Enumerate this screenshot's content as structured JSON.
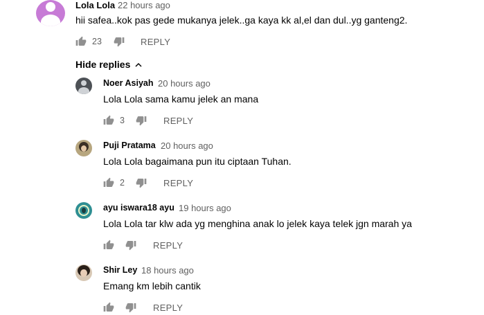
{
  "comment": {
    "author": "Lola Lola",
    "time": "22 hours ago",
    "text": "hii safea..kok pas gede mukanya jelek..ga kaya kk al,el dan dul..yg ganteng2.",
    "likes": "23",
    "reply_label": "REPLY"
  },
  "hide_replies_label": "Hide replies",
  "replies": [
    {
      "author": "Noer Asiyah",
      "time": "20 hours ago",
      "text": "Lola Lola sama kamu jelek an mana",
      "likes": "3",
      "reply_label": "REPLY"
    },
    {
      "author": "Puji Pratama",
      "time": "20 hours ago",
      "text": "Lola Lola bagaimana pun itu ciptaan Tuhan.",
      "likes": "2",
      "reply_label": "REPLY"
    },
    {
      "author": "ayu iswara18 ayu",
      "time": "19 hours ago",
      "text": "Lola Lola tar klw ada yg menghina anak lo jelek kaya telek jgn marah ya",
      "likes": "",
      "reply_label": "REPLY"
    },
    {
      "author": "Shir Ley",
      "time": "18 hours ago",
      "text": "Emang km lebih cantik",
      "likes": "",
      "reply_label": "REPLY"
    }
  ],
  "icons": {
    "like": "thumb-up-icon",
    "dislike": "thumb-down-icon",
    "chevron": "chevron-up-icon"
  }
}
